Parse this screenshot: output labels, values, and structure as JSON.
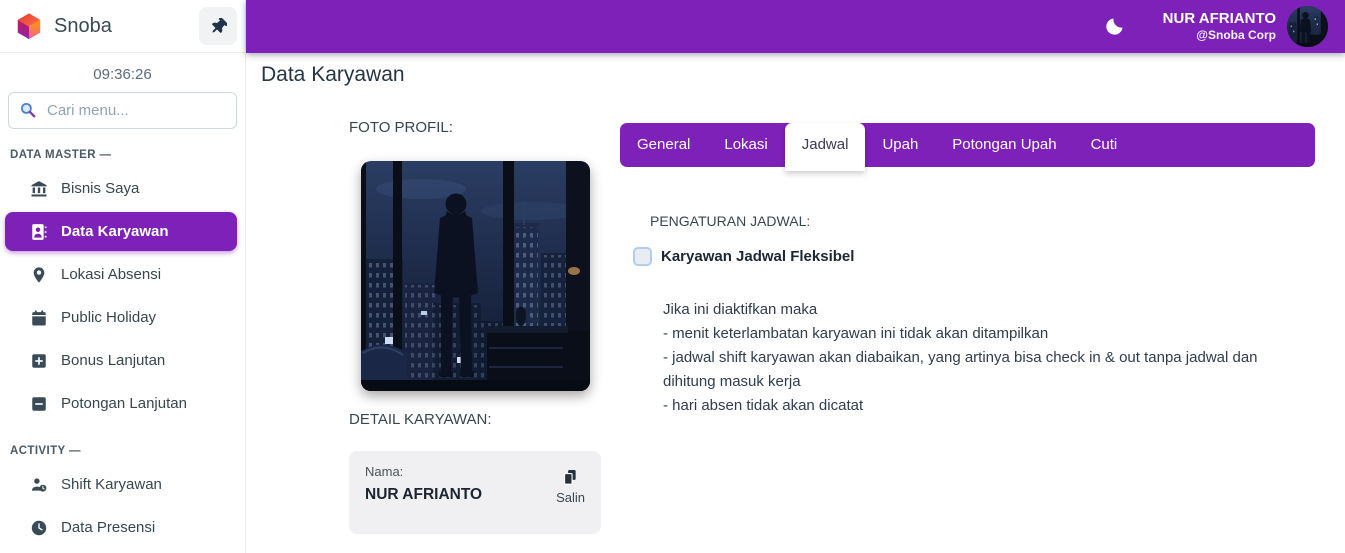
{
  "colors": {
    "accent": "#7d21b8",
    "sidebar_bg": "#ffffff",
    "card_bg": "#f0f0f2",
    "text_dark": "#2f3d4c"
  },
  "sidebar": {
    "brand": "Snoba",
    "time": "09:36:26",
    "search_placeholder": "Cari menu...",
    "sections": [
      {
        "label": "DATA MASTER —",
        "items": [
          {
            "icon": "bank-icon",
            "label": "Bisnis Saya",
            "active": false
          },
          {
            "icon": "id-badge-icon",
            "label": "Data Karyawan",
            "active": true
          },
          {
            "icon": "map-marker-icon",
            "label": "Lokasi Absensi",
            "active": false
          },
          {
            "icon": "calendar-icon",
            "label": "Public Holiday",
            "active": false
          },
          {
            "icon": "plus-square-icon",
            "label": "Bonus Lanjutan",
            "active": false
          },
          {
            "icon": "minus-square-icon",
            "label": "Potongan Lanjutan",
            "active": false
          }
        ]
      },
      {
        "label": "ACTIVITY —",
        "items": [
          {
            "icon": "user-clock-icon",
            "label": "Shift Karyawan",
            "active": false
          },
          {
            "icon": "clock-icon",
            "label": "Data Presensi",
            "active": false
          }
        ]
      }
    ]
  },
  "topbar": {
    "user_name": "NUR AFRIANTO",
    "user_org": "@Snoba Corp"
  },
  "main": {
    "title": "Data Karyawan",
    "photo_label": "FOTO PROFIL:",
    "detail_label": "DETAIL KARYAWAN:",
    "detail_card": {
      "field_label": "Nama:",
      "field_value": "NUR AFRIANTO",
      "copy_label": "Salin"
    },
    "tabs": [
      "General",
      "Lokasi",
      "Jadwal",
      "Upah",
      "Potongan Upah",
      "Cuti"
    ],
    "active_tab": "Jadwal",
    "panel": {
      "heading": "PENGATURAN JADWAL:",
      "checkbox_label": "Karyawan Jadwal Fleksibel",
      "checkbox_checked": false,
      "description_lines": [
        "Jika ini diaktifkan maka",
        "- menit keterlambatan karyawan ini tidak akan ditampilkan",
        "- jadwal shift karyawan akan diabaikan, yang artinya bisa check in & out tanpa jadwal dan dihitung masuk kerja",
        "- hari absen tidak akan dicatat"
      ]
    }
  }
}
